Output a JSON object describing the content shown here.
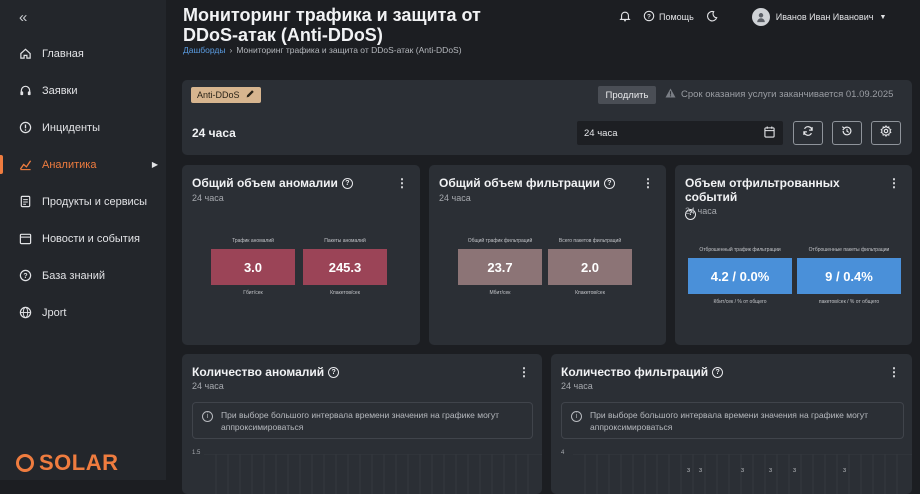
{
  "sidebar": {
    "collapse_label": "«",
    "items": [
      {
        "label": "Главная",
        "icon": "home-icon"
      },
      {
        "label": "Заявки",
        "icon": "headset-icon"
      },
      {
        "label": "Инциденты",
        "icon": "alert-icon"
      },
      {
        "label": "Аналитика",
        "icon": "chart-icon",
        "active": true
      },
      {
        "label": "Продукты и сервисы",
        "icon": "doc-icon"
      },
      {
        "label": "Новости и события",
        "icon": "calendar-icon"
      },
      {
        "label": "База знаний",
        "icon": "question-icon"
      },
      {
        "label": "Jport",
        "icon": "globe-icon"
      }
    ],
    "logo_text": "SOLAR"
  },
  "header": {
    "title": "Мониторинг трафика и защита от DDoS-атак (Anti-DDoS)",
    "breadcrumb_link": "Дашборды",
    "breadcrumb_separator": "›",
    "breadcrumb_current": "Мониторинг трафика и защита от DDoS-атак (Anti-DDoS)",
    "help_label": "Помощь",
    "user_name": "Иванов Иван Иванович"
  },
  "service": {
    "tag": "Anti-DDoS",
    "prolong_label": "Продлить",
    "expiry_text": "Срок оказания услуги заканчивается 01.09.2025",
    "period_label": "24 часа",
    "period_select": "24 часа"
  },
  "cards": {
    "anomalies": {
      "title": "Общий объем аномалии",
      "period": "24 часа",
      "metrics": [
        {
          "label": "Трафик аномалий",
          "value": "3.0",
          "unit": "Гбит/сек"
        },
        {
          "label": "Пакеты аномалий",
          "value": "245.3",
          "unit": "Кпакетов/сек"
        }
      ]
    },
    "filtration": {
      "title": "Общий объем фильтрации",
      "period": "24 часа",
      "metrics": [
        {
          "label": "Общий трафик фильтраций",
          "value": "23.7",
          "unit": "Мбит/сек"
        },
        {
          "label": "Всего пакетов фильтраций",
          "value": "2.0",
          "unit": "Кпакетов/сек"
        }
      ]
    },
    "filtered_events": {
      "title": "Объем отфильтрованных событий",
      "period": "24 часа",
      "metrics": [
        {
          "label": "Отброшенный трафик фильтрации",
          "value": "4.2 / 0.0%",
          "unit": "Кбит/сек / % от общего"
        },
        {
          "label": "Отброшенные пакеты фильтрации",
          "value": "9 / 0.4%",
          "unit": "пакетов/сек / % от общего"
        }
      ]
    },
    "anomaly_count": {
      "title": "Количество аномалий",
      "period": "24 часа",
      "notice": "При выборе большого интервала времени значения на графике могут аппроксимироваться",
      "y_tick": "1.5"
    },
    "filtration_count": {
      "title": "Количество фильтраций",
      "period": "24 часа",
      "notice": "При выборе большого интервала времени значения на графике могут аппроксимироваться",
      "y_tick": "4",
      "data_labels": [
        "3",
        "3",
        "3",
        "3",
        "3",
        "3"
      ]
    }
  },
  "colors": {
    "accent": "#ef7c3f",
    "anomaly_box": "#9b4457",
    "filtration_box": "#8c7476",
    "events_box": "#4a90d9"
  }
}
